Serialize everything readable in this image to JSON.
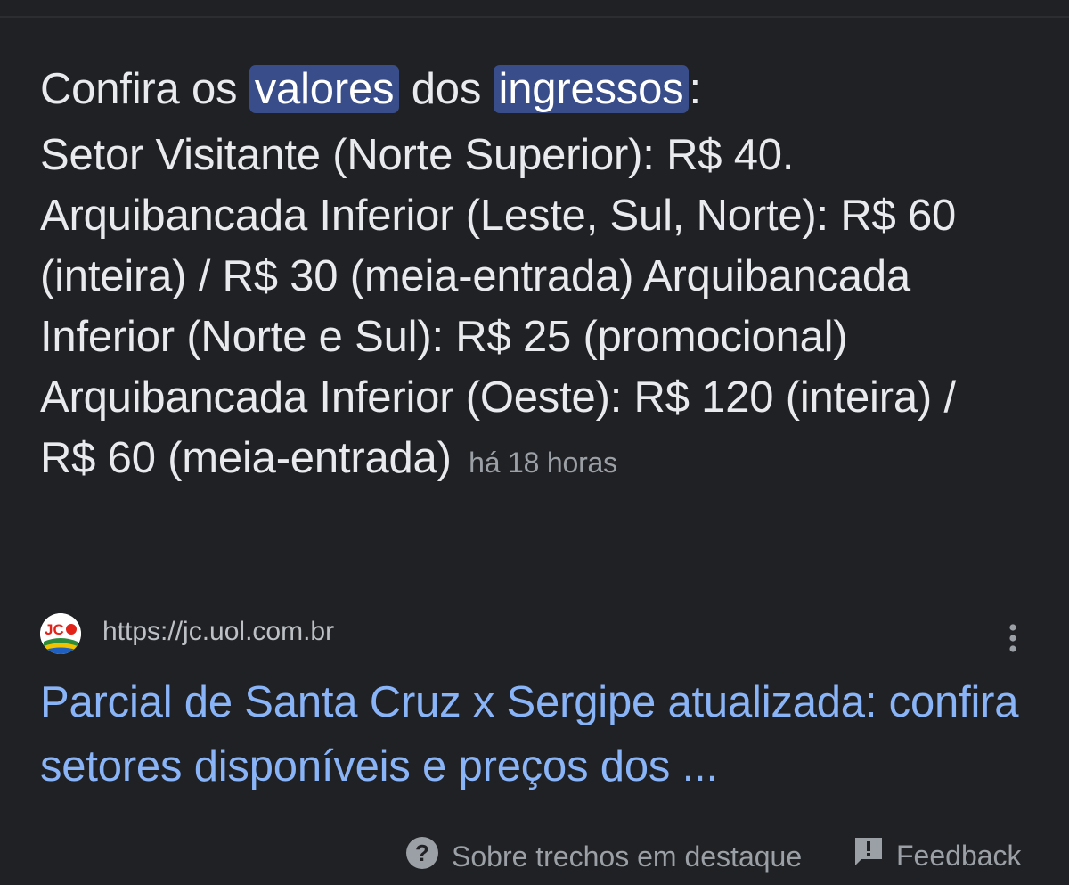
{
  "snippet": {
    "heading_prefix": "Confira os ",
    "heading_highlight_1": "valores",
    "heading_middle": " dos ",
    "heading_highlight_2": "ingressos",
    "heading_suffix": ":",
    "body": "Setor Visitante (Norte Superior): R$ 40. Arquibancada Inferior (Leste, Sul, Norte): R$ 60 (inteira) / R$ 30 (meia-entrada) Arquibancada Inferior (Norte e Sul): R$ 25 (promocional) Arquibancada Inferior (Oeste): R$ 120 (inteira) / R$ 60 (meia-entrada)",
    "timestamp": "há 18 horas"
  },
  "source": {
    "favicon_text": "JC",
    "url": "https://jc.uol.com.br",
    "menu_icon": "more-vert-icon"
  },
  "result": {
    "title": "Parcial de Santa Cruz x Sergipe atualizada: confira setores disponíveis e preços dos ..."
  },
  "footer": {
    "about_label": "Sobre trechos em destaque",
    "about_icon": "help-circle-icon",
    "feedback_label": "Feedback",
    "feedback_icon": "feedback-icon"
  },
  "colors": {
    "background": "#202124",
    "text": "#e8eaed",
    "highlight_bg": "#394d8a",
    "link": "#8ab4f8",
    "muted": "#9aa0a6"
  }
}
